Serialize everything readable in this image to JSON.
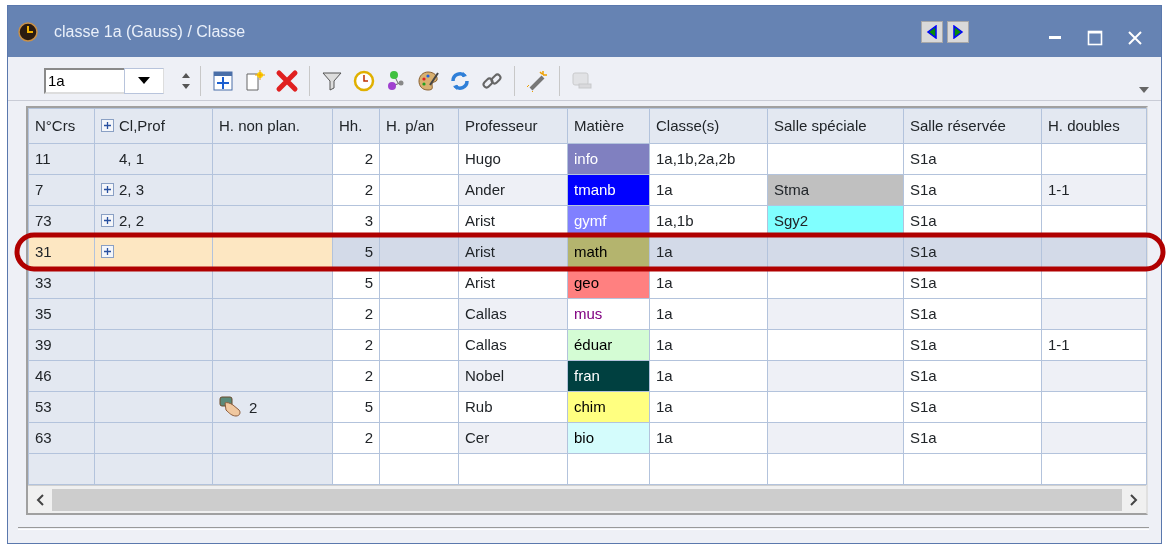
{
  "window": {
    "title": "classe 1a (Gauss) / Classe"
  },
  "toolbar": {
    "class_select": {
      "value": "1a"
    },
    "tools": [
      {
        "kind": "grid",
        "disabled": false
      },
      {
        "kind": "new",
        "disabled": false
      },
      {
        "kind": "delete",
        "disabled": false
      },
      {
        "kind": "filter",
        "disabled": false
      },
      {
        "kind": "clock",
        "disabled": false
      },
      {
        "kind": "nodes",
        "disabled": false
      },
      {
        "kind": "palette",
        "disabled": false
      },
      {
        "kind": "refresh",
        "disabled": false
      },
      {
        "kind": "link",
        "disabled": false
      },
      {
        "kind": "wand",
        "disabled": false
      },
      {
        "kind": "screen",
        "disabled": true
      }
    ]
  },
  "table": {
    "columns": [
      "N°Crs",
      "Cl,Prof",
      "H. non plan.",
      "Hh.",
      "H. p/an",
      "Professeur",
      "Matière",
      "Classe(s)",
      "Salle spéciale",
      "Salle réservée",
      "H. doubles"
    ],
    "rows": [
      {
        "selected": false,
        "course": "11",
        "cl_prof": {
          "expandable": false,
          "text": "4, 1"
        },
        "hh": "2",
        "professeur": "Hugo",
        "matiere": {
          "text": "info",
          "color": "#8080c0",
          "kind": "background"
        },
        "classes": "1a,1b,2a,2b",
        "salle_reservee": "S1a"
      },
      {
        "selected": false,
        "course": "7",
        "cl_prof": {
          "expandable": true,
          "text": "2, 3"
        },
        "hh": "2",
        "professeur": "Ander",
        "matiere": {
          "text": "tmanb",
          "color": "#0000ff",
          "kind": "background"
        },
        "classes": "1a",
        "salle_speciale": {
          "text": "Stma",
          "color": "#c0c0c0"
        },
        "salle_reservee": "S1a",
        "h_doubles": "1-1"
      },
      {
        "selected": false,
        "course": "73",
        "cl_prof": {
          "expandable": true,
          "text": "2, 2"
        },
        "hh": "3",
        "professeur": "Arist",
        "matiere": {
          "text": "gymf",
          "color": "#8080ff",
          "kind": "background"
        },
        "classes": "1a,1b",
        "salle_speciale": {
          "text": "Sgy2",
          "color": "#80ffff"
        },
        "salle_reservee": "S1a"
      },
      {
        "selected": true,
        "course": "31",
        "cl_prof": {
          "expandable": true
        },
        "hh": "5",
        "professeur": "Arist",
        "matiere": {
          "text": "math",
          "color": "#b4b46e",
          "kind": "background"
        },
        "classes": "1a",
        "salle_reservee": "S1a"
      },
      {
        "selected": false,
        "course": "33",
        "cl_prof": {
          "expandable": false
        },
        "hh": "5",
        "professeur": "Arist",
        "matiere": {
          "text": "geo",
          "color": "#ff8080",
          "kind": "background"
        },
        "classes": "1a",
        "salle_reservee": "S1a"
      },
      {
        "selected": false,
        "course": "35",
        "cl_prof": {
          "expandable": false
        },
        "hh": "2",
        "professeur": "Callas",
        "matiere": {
          "text": "mus",
          "color": "#800080",
          "kind": "foreground"
        },
        "classes": "1a",
        "salle_reservee": "S1a"
      },
      {
        "selected": false,
        "course": "39",
        "cl_prof": {
          "expandable": false
        },
        "hh": "2",
        "professeur": "Callas",
        "matiere": {
          "text": "éduar",
          "color": "#d4fcd4",
          "kind": "background"
        },
        "classes": "1a",
        "salle_reservee": "S1a",
        "h_doubles": "1-1"
      },
      {
        "selected": false,
        "course": "46",
        "cl_prof": {
          "expandable": false
        },
        "hh": "2",
        "professeur": "Nobel",
        "matiere": {
          "text": "fran",
          "color": "#004040",
          "kind": "background"
        },
        "classes": "1a",
        "salle_reservee": "S1a"
      },
      {
        "selected": false,
        "course": "53",
        "cl_prof": {
          "expandable": false
        },
        "h_non_plan": "2",
        "hh": "5",
        "professeur": "Rub",
        "matiere": {
          "text": "chim",
          "color": "#ffff80",
          "kind": "background"
        },
        "classes": "1a",
        "salle_reservee": "S1a"
      },
      {
        "selected": false,
        "course": "63",
        "cl_prof": {
          "expandable": false
        },
        "hh": "2",
        "professeur": "Cer",
        "matiere": {
          "text": "bio",
          "color": "#d4fcfc",
          "kind": "background"
        },
        "classes": "1a",
        "salle_reservee": "S1a"
      }
    ]
  }
}
